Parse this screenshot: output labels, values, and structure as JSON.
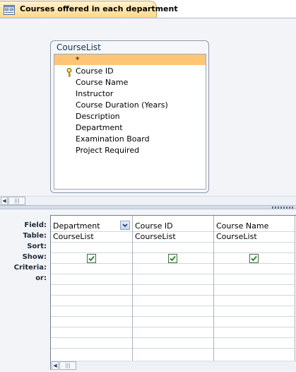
{
  "tab": {
    "title": "Courses offered in each department"
  },
  "field_list": {
    "title": "CourseList",
    "items": [
      "*",
      "Course ID",
      "Course Name",
      "Instructor",
      "Course Duration (Years)",
      "Description",
      "Department",
      "Examination Board",
      "Project Required"
    ],
    "selected_index": 0,
    "primary_key_index": 1
  },
  "grid": {
    "row_labels": [
      "Field:",
      "Table:",
      "Sort:",
      "Show:",
      "Criteria:",
      "or:"
    ],
    "columns": [
      {
        "field": "Department",
        "table": "CourseList",
        "sort": "",
        "show": true,
        "criteria": "",
        "or": ""
      },
      {
        "field": "Course ID",
        "table": "CourseList",
        "sort": "",
        "show": true,
        "criteria": "",
        "or": ""
      },
      {
        "field": "Course Name",
        "table": "CourseList",
        "sort": "",
        "show": true,
        "criteria": "",
        "or": ""
      }
    ]
  },
  "colors": {
    "tab_gradient_top": "#fff3cf",
    "tab_gradient_bottom": "#ffd88c",
    "selected_field": "#ffc577",
    "check_green": "#2f8a2f",
    "background": "#f2f4f8"
  },
  "icons": [
    "query-tab-icon",
    "primary-key-icon",
    "dropdown-arrow-icon",
    "checkbox-checked-icon",
    "scroll-left-arrow-icon",
    "scroll-thumb-grip-icon"
  ]
}
